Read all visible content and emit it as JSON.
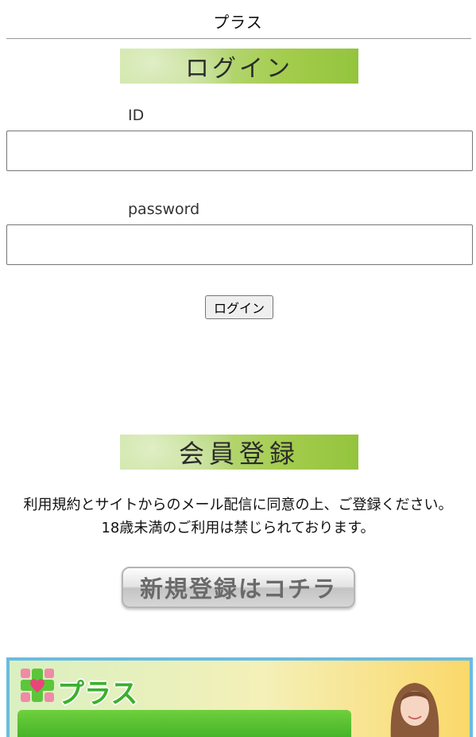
{
  "header": {
    "title": "プラス"
  },
  "login": {
    "banner_text": "ログイン",
    "id_label": "ID",
    "id_value": "",
    "password_label": "password",
    "password_value": "",
    "button_label": "ログイン"
  },
  "register": {
    "banner_text": "会員登録",
    "consent_line1": "利用規約とサイトからのメール配信に同意の上、ご登録ください。",
    "consent_line2": "18歳未満のご利用は禁じられております。",
    "signup_button_label": "新規登録はコチラ"
  },
  "promo": {
    "brand_text": "プラス",
    "accent_colors": {
      "green": "#3cb02e",
      "border": "#6bbbe0",
      "heart": "#e8457a"
    }
  }
}
